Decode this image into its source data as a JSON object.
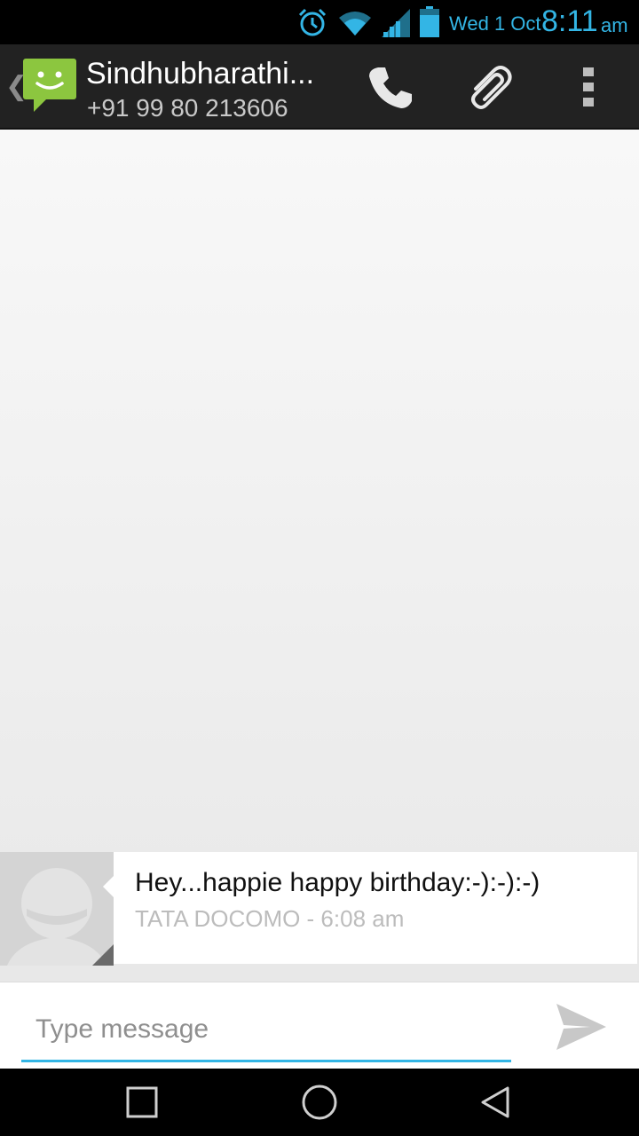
{
  "status_bar": {
    "date": "Wed 1 Oct",
    "time": "8:11",
    "ampm": "am",
    "icons": [
      "alarm-icon",
      "wifi-icon",
      "signal-icon",
      "battery-icon"
    ],
    "accent": "#33b5e5"
  },
  "action_bar": {
    "contact_name": "Sindhubharathi...",
    "contact_number": "+91 99 80 213606",
    "icons": [
      "up-caret-icon",
      "messaging-app-icon",
      "phone-icon",
      "attach-icon",
      "overflow-menu-icon"
    ],
    "app_icon_color": "#8cc63f"
  },
  "messages": [
    {
      "text": "Hey...happie happy birthday:-):-):-)",
      "meta": "TATA DOCOMO - 6:08 am",
      "avatar": "contact-placeholder-icon"
    }
  ],
  "compose": {
    "placeholder": "Type message",
    "send_icon": "send-icon"
  },
  "nav_bar": {
    "icons": [
      "recent-apps-icon",
      "home-icon",
      "back-icon"
    ]
  }
}
